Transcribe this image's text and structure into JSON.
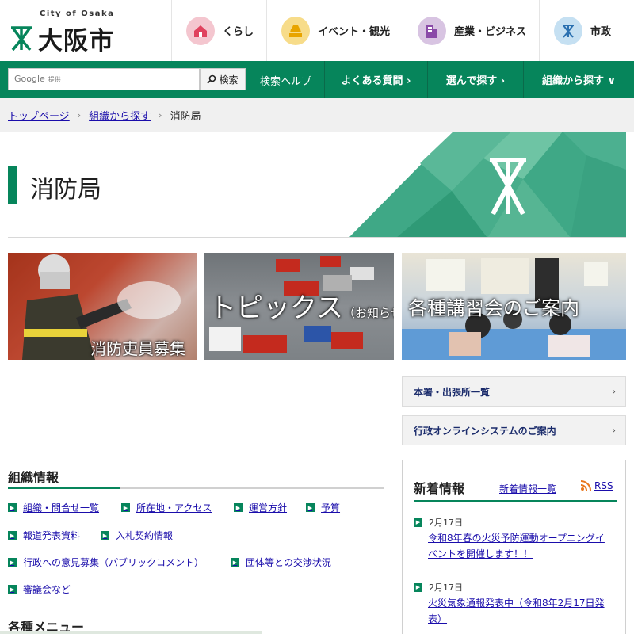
{
  "header": {
    "logo_sub": "City of Osaka",
    "logo_main": "大阪市",
    "nav": [
      {
        "label": "くらし",
        "icon": "house-icon",
        "color": "#f4c6cf"
      },
      {
        "label": "イベント・観光",
        "icon": "castle-icon",
        "color": "#f7dc8a"
      },
      {
        "label": "産業・ビジネス",
        "icon": "building-icon",
        "color": "#d8c4e2"
      },
      {
        "label": "市政",
        "icon": "city-emblem-icon",
        "color": "#c5e0f2"
      }
    ]
  },
  "gnav": {
    "search_placeholder": "Google",
    "search_provided": "提供",
    "search_button": "検索",
    "search_help": "検索ヘルプ",
    "items": [
      {
        "label": "よくある質問 ›"
      },
      {
        "label": "選んで探す ›"
      },
      {
        "label": "組織から探す ∨"
      }
    ]
  },
  "breadcrumb": {
    "items": [
      "トップページ",
      "組織から探す"
    ],
    "current": "消防局"
  },
  "hero": {
    "title": "消防局"
  },
  "banners": [
    {
      "caption": "消防吏員募集"
    },
    {
      "caption": "トピックス",
      "caption_sub": "（お知らせ）"
    },
    {
      "caption": "各種講習会のご案内"
    }
  ],
  "right_links": [
    {
      "label": "本署・出張所一覧"
    },
    {
      "label": "行政オンラインシステムのご案内"
    }
  ],
  "org": {
    "title": "組織情報",
    "links": [
      "組織・問合せ一覧",
      "所在地・アクセス",
      "運営方針",
      "予算",
      "報道発表資料",
      "入札契約情報",
      "行政への意見募集（パブリックコメント）",
      "団体等との交渉状況",
      "審議会など"
    ]
  },
  "menu": {
    "title": "各種メニュー"
  },
  "news": {
    "title": "新着情報",
    "list_link": "新着情報一覧",
    "rss": "RSS",
    "items": [
      {
        "date": "2月17日",
        "text": "令和8年春の火災予防運動オープニングイベントを開催します！！"
      },
      {
        "date": "2月17日",
        "text": "火災気象通報発表中（令和8年2月17日発表）"
      }
    ]
  },
  "colors": {
    "brand_green": "#06855b",
    "link": "#1a0dab"
  }
}
